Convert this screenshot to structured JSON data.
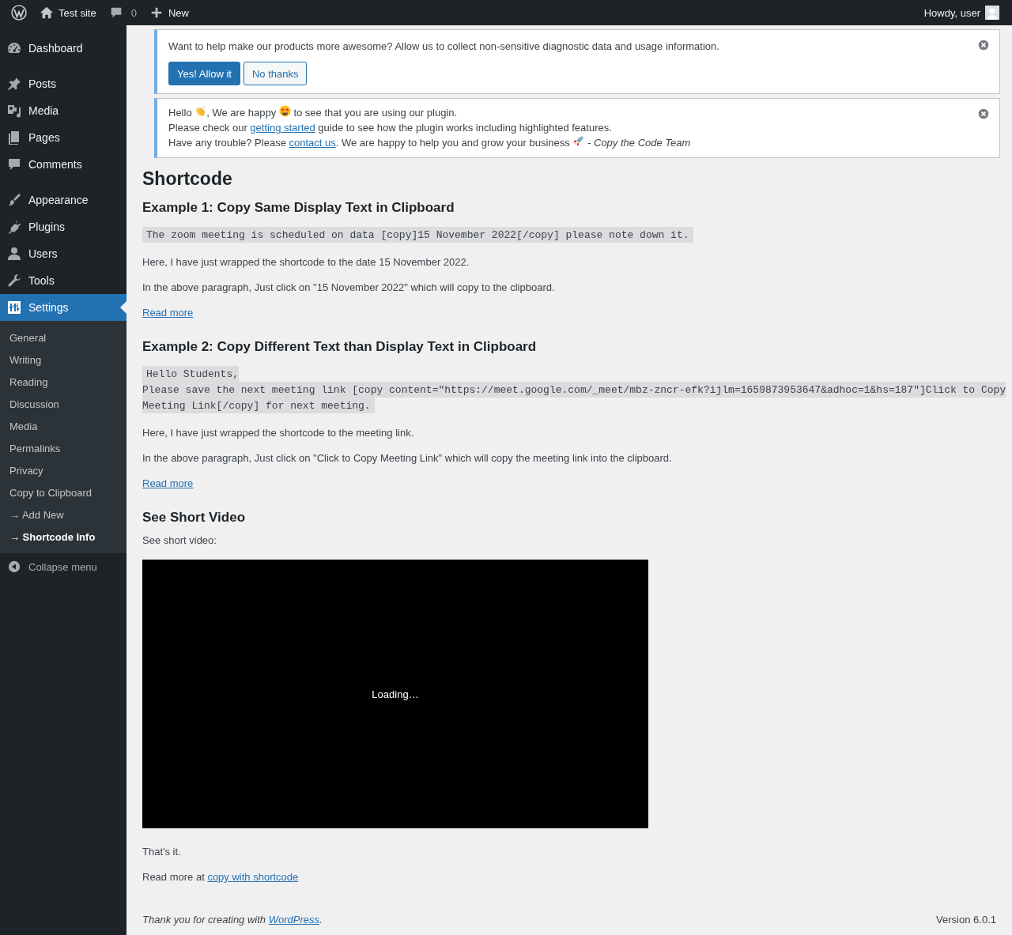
{
  "admin_bar": {
    "site": "Test site",
    "comments": "0",
    "new": "New",
    "greeting": "Howdy, user"
  },
  "menu": {
    "sections": [
      {
        "items": [
          {
            "label": "Dashboard",
            "selected": false
          }
        ]
      },
      {
        "items": [
          {
            "label": "Posts",
            "selected": false
          },
          {
            "label": "Media",
            "selected": false
          },
          {
            "label": "Pages",
            "selected": false
          },
          {
            "label": "Comments",
            "selected": false
          }
        ]
      },
      {
        "items": [
          {
            "label": "Appearance",
            "selected": false
          },
          {
            "label": "Plugins",
            "selected": false
          },
          {
            "label": "Users",
            "selected": false
          },
          {
            "label": "Tools",
            "selected": false
          },
          {
            "label": "Settings",
            "selected": true
          }
        ]
      }
    ],
    "submenu": [
      {
        "label": "General",
        "selected": false
      },
      {
        "label": "Writing",
        "selected": false
      },
      {
        "label": "Reading",
        "selected": false
      },
      {
        "label": "Discussion",
        "selected": false
      },
      {
        "label": "Media",
        "selected": false
      },
      {
        "label": "Permalinks",
        "selected": false
      },
      {
        "label": "Privacy",
        "selected": false
      },
      {
        "label": "Copy to Clipboard",
        "selected": false
      },
      {
        "label": "→ Add New",
        "selected": false
      },
      {
        "label": "→ Shortcode Info",
        "selected": true
      }
    ],
    "collapse": "Collapse menu"
  },
  "notices": [
    {
      "kind": "prompt",
      "text": "Want to help make our products more awesome? Allow us to collect non-sensitive diagnostic data and usage information.",
      "buttons": [
        {
          "label": "Yes! Allow it",
          "kind": "primary"
        },
        {
          "label": "No thanks",
          "kind": "secondary"
        }
      ]
    },
    {
      "kind": "message",
      "lines": [
        [
          {
            "kind": "text",
            "text": "Hello "
          },
          {
            "kind": "emoji"
          },
          {
            "kind": "text",
            "text": ", We are happy "
          },
          {
            "kind": "emoji"
          },
          {
            "kind": "text",
            "text": " to see that you are using our plugin."
          }
        ],
        [
          {
            "kind": "text",
            "text": "Please check our "
          },
          {
            "kind": "link",
            "text": "getting started"
          },
          {
            "kind": "text",
            "text": " guide to see how the plugin works including highlighted features."
          }
        ],
        [
          {
            "kind": "text",
            "text": "Have any trouble? Please "
          },
          {
            "kind": "link",
            "text": "contact us"
          },
          {
            "kind": "text",
            "text": ". We are happy to help you and grow your business "
          },
          {
            "kind": "emoji"
          },
          {
            "kind": "text",
            "text": " *- Copy the Code Team*"
          }
        ]
      ]
    }
  ],
  "content": {
    "title": "Shortcode",
    "blocks": [
      {
        "kind": "heading",
        "text": "Example 1: Copy Same Display Text in Clipboard"
      },
      {
        "kind": "code",
        "lines": [
          "The zoom meeting is scheduled on data [copy]15 November 2022[/copy] please note down it."
        ]
      },
      {
        "kind": "paragraph",
        "parts": [
          {
            "kind": "text",
            "text": "Here, I have just wrapped the shortcode to the date 15 November 2022."
          }
        ]
      },
      {
        "kind": "paragraph",
        "parts": [
          {
            "kind": "text",
            "text": "In the above paragraph, Just click on \"15 November 2022\" which will copy to the clipboard."
          }
        ]
      },
      {
        "kind": "paragraph",
        "parts": [
          {
            "kind": "link",
            "text": "Read more"
          }
        ]
      },
      {
        "kind": "heading",
        "text": "Example 2: Copy Different Text than Display Text in Clipboard"
      },
      {
        "kind": "code",
        "lines": [
          "Hello Students,",
          "Please save the next meeting link [copy content=\"https://meet.google.com/_meet/mbz-zncr-efk?ijlm=1659873953647&adhoc=1&hs=187\"]Click to Copy Meeting Link[/copy] for next meeting."
        ]
      },
      {
        "kind": "paragraph",
        "parts": [
          {
            "kind": "text",
            "text": "Here, I have just wrapped the shortcode to the meeting link."
          }
        ]
      },
      {
        "kind": "paragraph",
        "parts": [
          {
            "kind": "text",
            "text": "In the above paragraph, Just click on \"Click to Copy Meeting Link\" which will copy the meeting link into the clipboard."
          }
        ]
      },
      {
        "kind": "paragraph",
        "parts": [
          {
            "kind": "link",
            "text": "Read more"
          }
        ]
      },
      {
        "kind": "heading",
        "text": "See Short Video"
      },
      {
        "kind": "paragraph",
        "parts": [
          {
            "kind": "text",
            "text": "See short video:"
          }
        ]
      },
      {
        "kind": "video",
        "status": "Loading…"
      },
      {
        "kind": "paragraph",
        "parts": [
          {
            "kind": "text",
            "text": "That's it."
          }
        ]
      },
      {
        "kind": "paragraph",
        "parts": [
          {
            "kind": "text",
            "text": "Read more at "
          },
          {
            "kind": "link",
            "text": "copy with shortcode"
          }
        ]
      }
    ]
  },
  "footer": {
    "thanks": [
      {
        "kind": "text",
        "text": "Thank you for creating with "
      },
      {
        "kind": "link",
        "text": "WordPress"
      },
      {
        "kind": "text",
        "text": "."
      }
    ],
    "version": "Version 6.0.1"
  }
}
